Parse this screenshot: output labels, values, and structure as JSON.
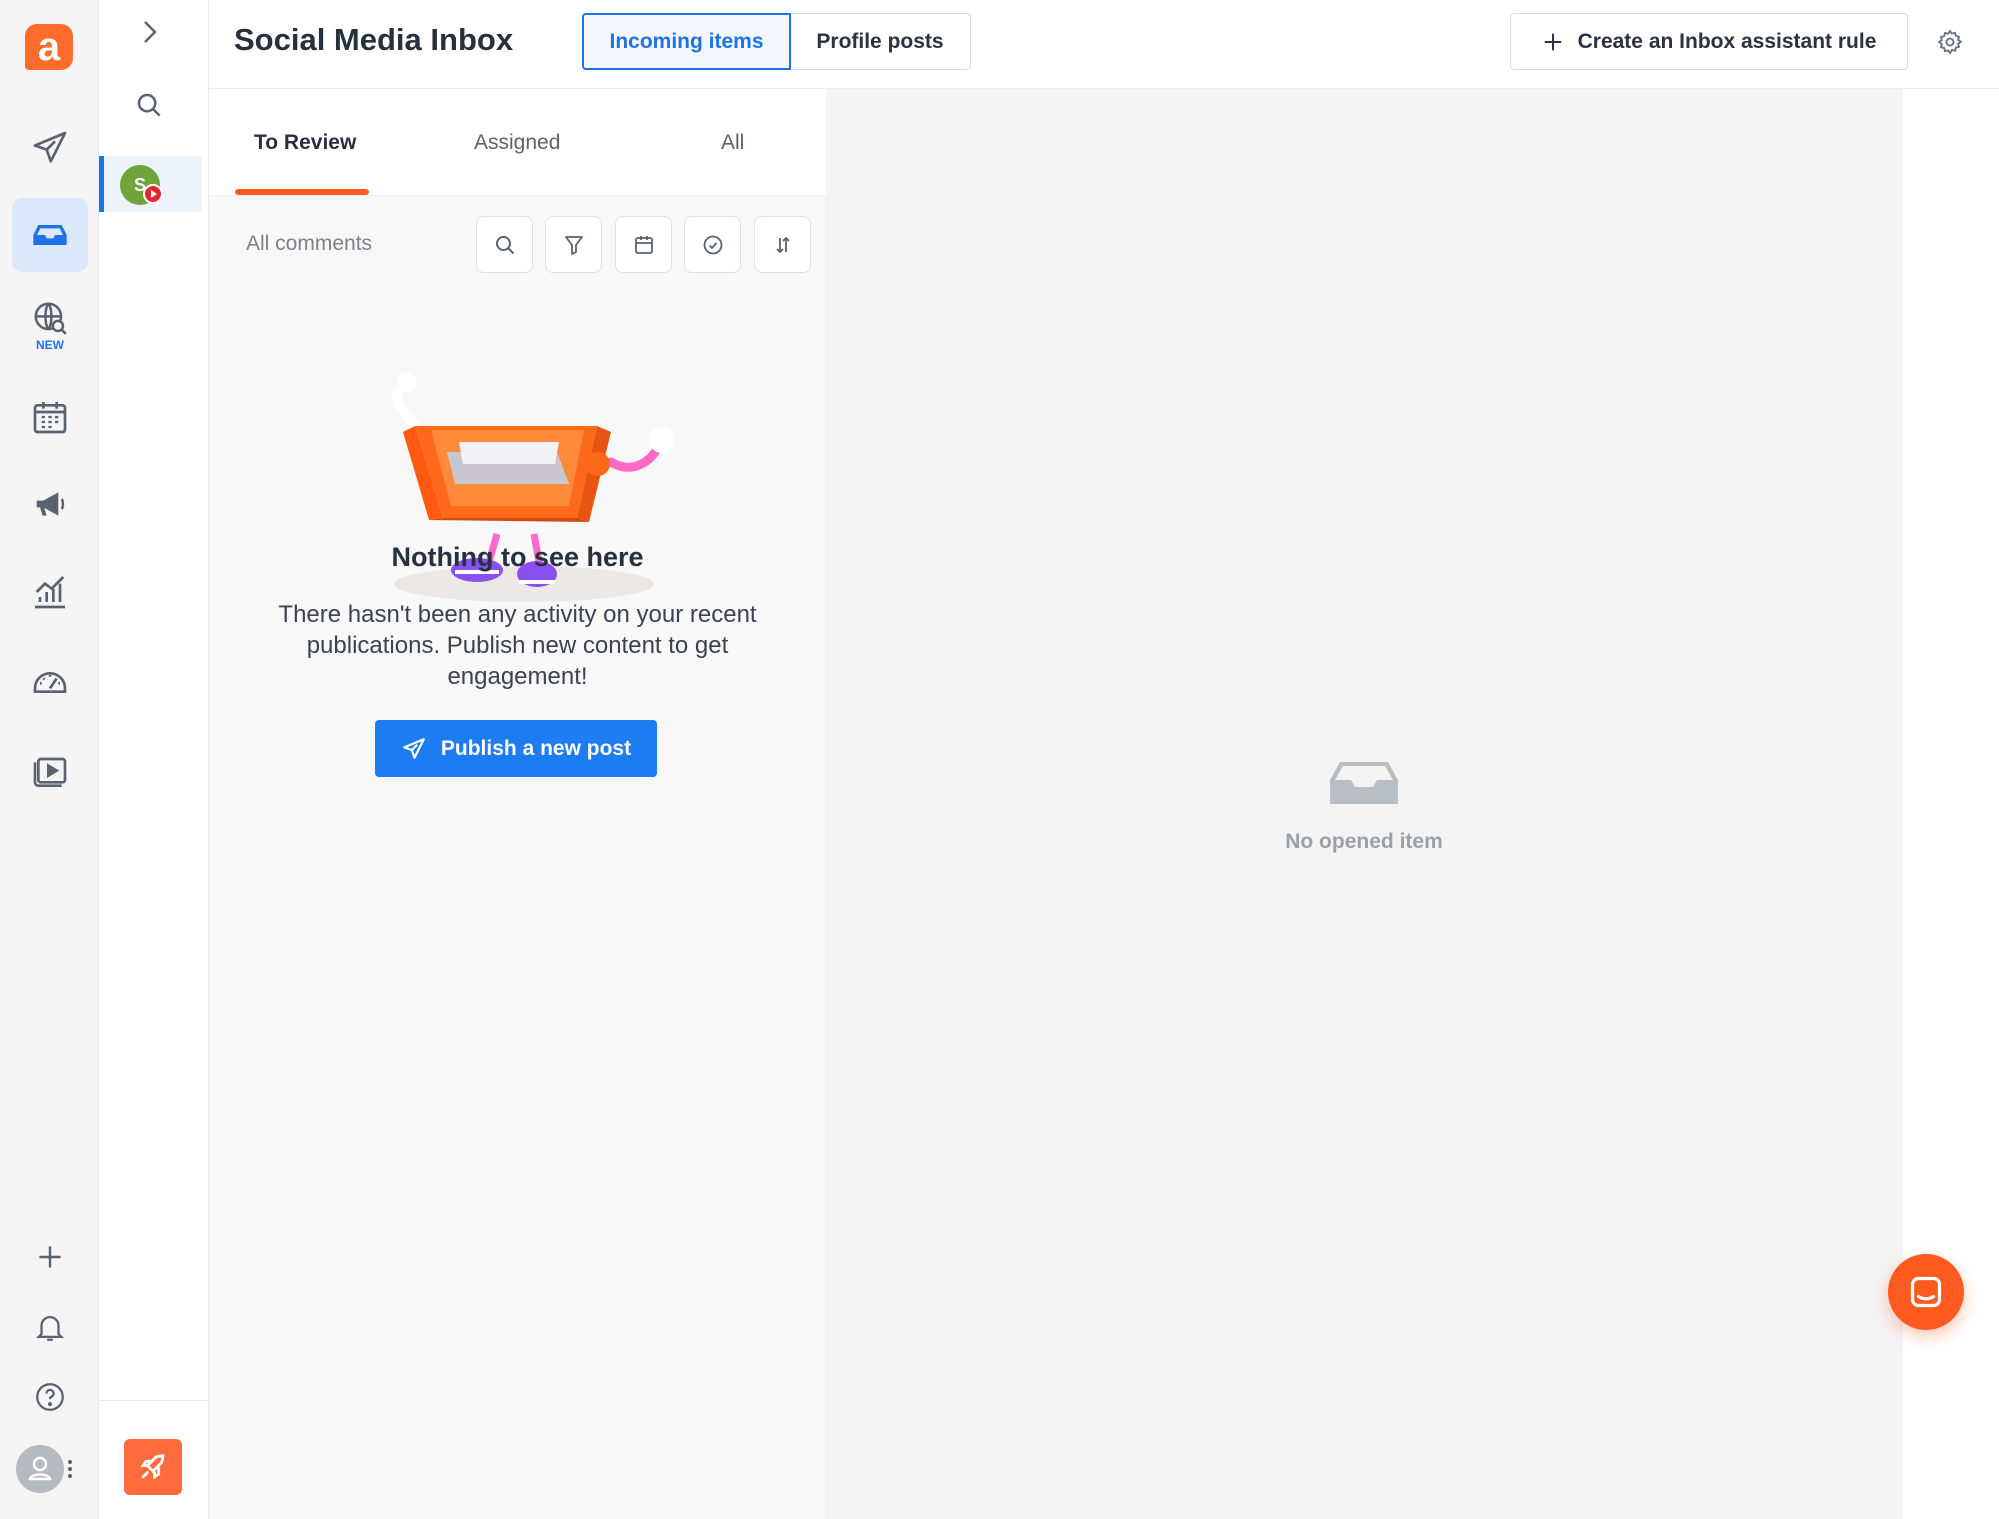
{
  "app": {
    "logo_letter": "a",
    "brand_color": "#ff6b2b",
    "accent_color": "#1e73e8"
  },
  "nav": {
    "items": [
      {
        "icon": "paper-plane-icon"
      },
      {
        "icon": "inbox-tray-icon",
        "active": true
      },
      {
        "icon": "globe-search-icon",
        "badge": "NEW"
      },
      {
        "icon": "calendar-icon"
      },
      {
        "icon": "megaphone-icon"
      },
      {
        "icon": "analytics-chart-icon"
      },
      {
        "icon": "speedometer-icon"
      },
      {
        "icon": "media-library-icon"
      }
    ],
    "bottom": [
      {
        "icon": "plus-icon"
      },
      {
        "icon": "bell-icon"
      },
      {
        "icon": "help-icon"
      },
      {
        "icon": "user-avatar-icon"
      }
    ]
  },
  "profiles": {
    "selected_initial": "S",
    "network": "youtube"
  },
  "header": {
    "title": "Social Media Inbox",
    "segments": [
      "Incoming items",
      "Profile posts"
    ],
    "rule_button": "Create an Inbox assistant rule"
  },
  "list": {
    "tabs": [
      "To Review",
      "Assigned",
      "All"
    ],
    "active_tab": "To Review",
    "filter_label": "All comments",
    "empty": {
      "title": "Nothing to see here",
      "text": "There hasn't been any activity on your recent publications. Publish new content to get engagement!",
      "button": "Publish a new post"
    }
  },
  "detail": {
    "empty_label": "No opened item"
  }
}
